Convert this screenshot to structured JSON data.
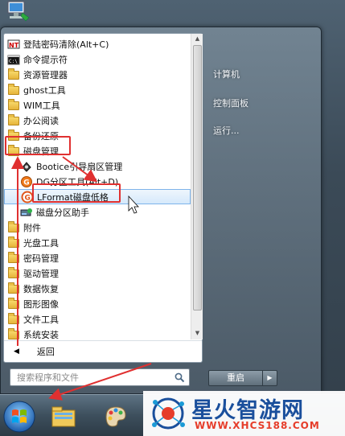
{
  "menu": {
    "items": [
      {
        "label": "登陆密码清除(Alt+C)",
        "icon": "nt-password-icon"
      },
      {
        "label": "命令提示符",
        "icon": "cmd-icon"
      },
      {
        "label": "资源管理器",
        "icon": "folder-icon"
      },
      {
        "label": "ghost工具",
        "icon": "folder-icon"
      },
      {
        "label": "WIM工具",
        "icon": "folder-icon"
      },
      {
        "label": "办公阅读",
        "icon": "folder-icon"
      },
      {
        "label": "备份还原",
        "icon": "folder-icon"
      },
      {
        "label": "磁盘管理",
        "icon": "folder-icon"
      },
      {
        "label": "Bootice引导扇区管理",
        "icon": "bootice-icon"
      },
      {
        "label": "DG分区工具(Alt+D)",
        "icon": "diskgenius-icon"
      },
      {
        "label": "LFormat磁盘低格",
        "icon": "lformat-icon"
      },
      {
        "label": "磁盘分区助手",
        "icon": "partition-assistant-icon"
      },
      {
        "label": "附件",
        "icon": "folder-icon"
      },
      {
        "label": "光盘工具",
        "icon": "folder-icon"
      },
      {
        "label": "密码管理",
        "icon": "folder-icon"
      },
      {
        "label": "驱动管理",
        "icon": "folder-icon"
      },
      {
        "label": "数据恢复",
        "icon": "folder-icon"
      },
      {
        "label": "图形图像",
        "icon": "folder-icon"
      },
      {
        "label": "文件工具",
        "icon": "folder-icon"
      },
      {
        "label": "系统安装",
        "icon": "folder-icon"
      }
    ],
    "back_label": "返回",
    "search_placeholder": "搜索程序和文件"
  },
  "right_pane": {
    "links": [
      "计算机",
      "控制面板",
      "运行..."
    ],
    "restart_label": "重启"
  },
  "watermark": {
    "title": "星火智游网",
    "url": "WWW.XHCS188.COM"
  },
  "colors": {
    "highlight_border": "#7eb4ea",
    "annotation_red": "#e03030",
    "watermark_blue": "#1a4f9c",
    "watermark_red": "#e63d2a"
  }
}
